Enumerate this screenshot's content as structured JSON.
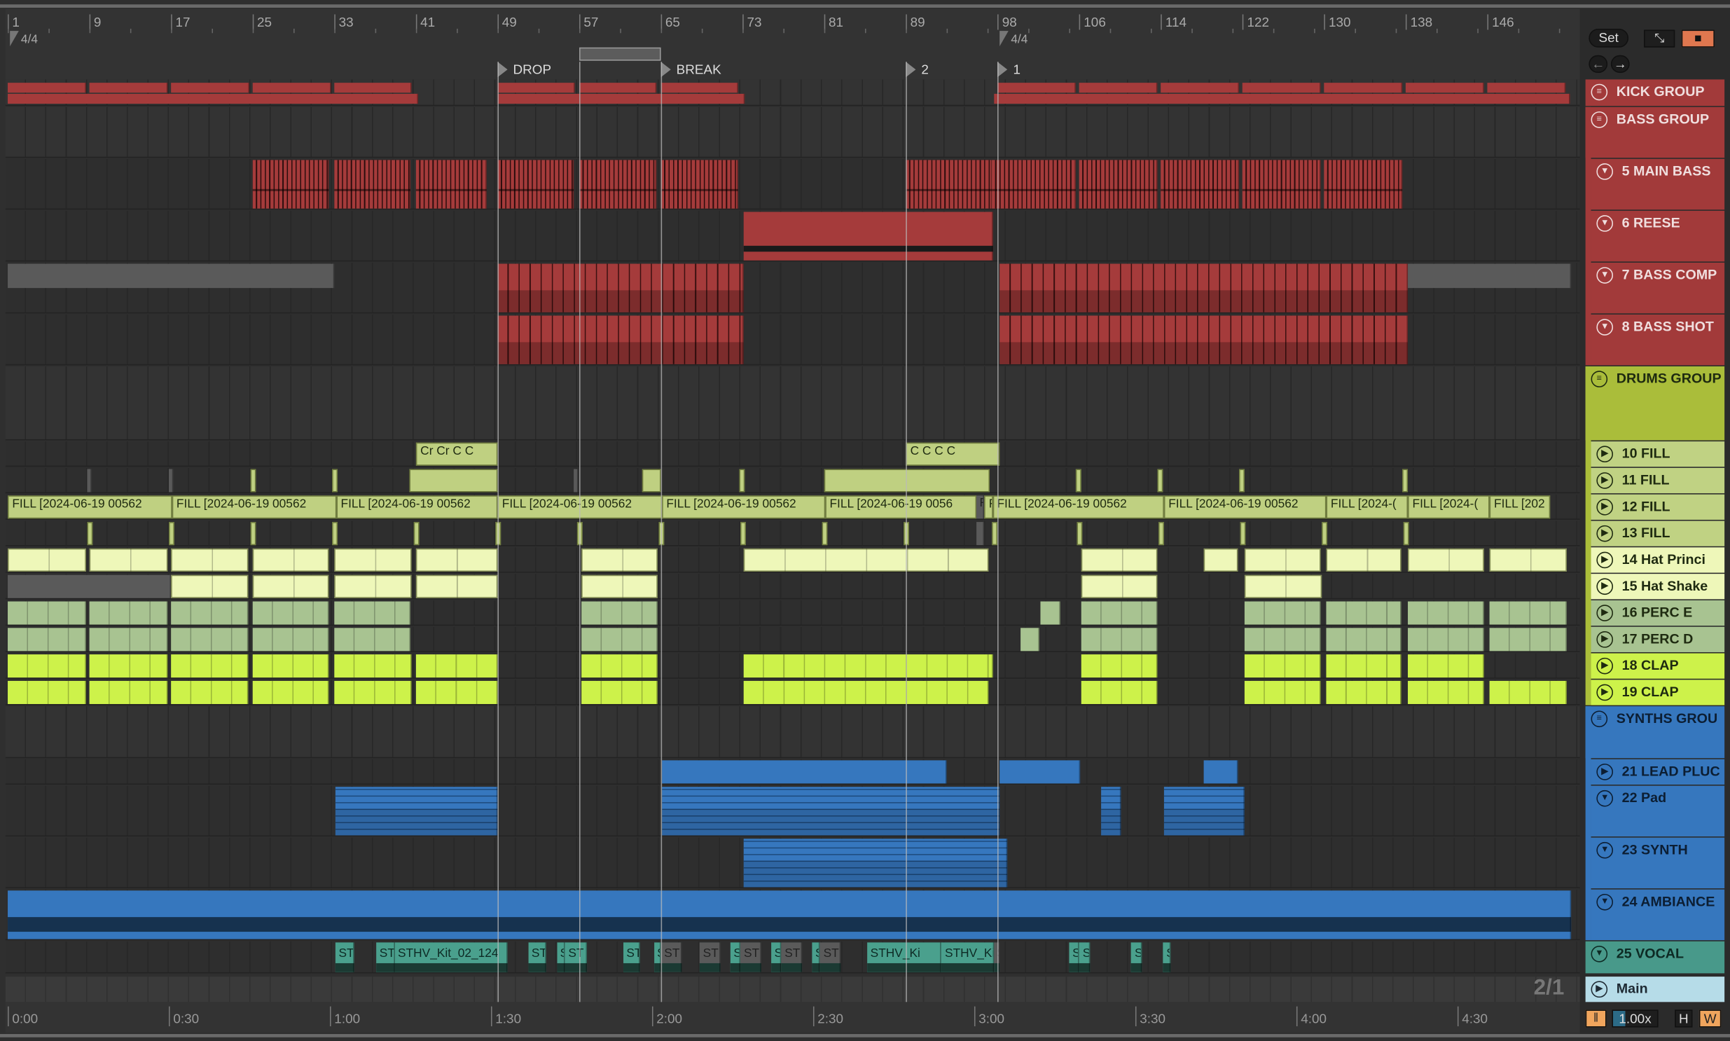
{
  "colors": {
    "red": "#a53b3b",
    "grey": "#5a5a5a",
    "fill": "#bfd081",
    "hat": "#eef7b9",
    "perc": "#a8c391",
    "clap": "#cdf24a",
    "blue": "#3677be",
    "teal": "#4aa08d",
    "drumgrp": "#aabd3a",
    "main": "#b6dce8",
    "orange": "#f0a55d"
  },
  "ruler": {
    "bars": [
      {
        "label": "1",
        "bar": 1
      },
      {
        "label": "9",
        "bar": 9
      },
      {
        "label": "17",
        "bar": 17
      },
      {
        "label": "25",
        "bar": 25
      },
      {
        "label": "33",
        "bar": 33
      },
      {
        "label": "41",
        "bar": 41
      },
      {
        "label": "49",
        "bar": 49
      },
      {
        "label": "57",
        "bar": 57
      },
      {
        "label": "65",
        "bar": 65
      },
      {
        "label": "73",
        "bar": 73
      },
      {
        "label": "81",
        "bar": 81
      },
      {
        "label": "89",
        "bar": 89
      },
      {
        "label": "98",
        "bar": 98
      },
      {
        "label": "106",
        "bar": 106
      },
      {
        "label": "114",
        "bar": 114
      },
      {
        "label": "122",
        "bar": 122
      },
      {
        "label": "130",
        "bar": 130
      },
      {
        "label": "138",
        "bar": 138
      },
      {
        "label": "146",
        "bar": 146
      }
    ],
    "time_signatures": [
      {
        "label": "4/4",
        "bar": 1
      },
      {
        "label": "4/4",
        "bar": 98
      }
    ],
    "locators": [
      {
        "label": "DROP",
        "bar": 49
      },
      {
        "label": "BREAK",
        "bar": 65
      },
      {
        "label": "2",
        "bar": 89
      },
      {
        "label": "1",
        "bar": 98
      }
    ],
    "loop": {
      "start": 57,
      "end": 65
    }
  },
  "time_ruler": [
    {
      "label": "0:00",
      "sec": 0
    },
    {
      "label": "0:30",
      "sec": 30
    },
    {
      "label": "1:00",
      "sec": 60
    },
    {
      "label": "1:30",
      "sec": 90
    },
    {
      "label": "2:00",
      "sec": 120
    },
    {
      "label": "2:30",
      "sec": 150
    },
    {
      "label": "3:00",
      "sec": 180
    },
    {
      "label": "3:30",
      "sec": 210
    },
    {
      "label": "4:00",
      "sec": 240
    },
    {
      "label": "4:30",
      "sec": 270
    }
  ],
  "controls": {
    "set": "Set",
    "zoom": "1.00x",
    "h": "H",
    "w": "W",
    "ratio": "2/1"
  },
  "tracks": [
    {
      "name": "KICK GROUP",
      "type": "group",
      "color": "red",
      "clips": [
        [
          1,
          8.7,
          "red"
        ],
        [
          9,
          16.7,
          "red"
        ],
        [
          17,
          24.7,
          "red"
        ],
        [
          25,
          32.7,
          "red"
        ],
        [
          33,
          40.6,
          "red"
        ],
        [
          49,
          56.6,
          "red"
        ],
        [
          57,
          64.6,
          "red"
        ],
        [
          65,
          72.6,
          "red"
        ],
        [
          98,
          105.7,
          "red"
        ],
        [
          106,
          113.7,
          "red"
        ],
        [
          114,
          121.6,
          "red"
        ],
        [
          122,
          129.6,
          "red"
        ],
        [
          130,
          137.6,
          "red"
        ],
        [
          138,
          145.6,
          "red"
        ],
        [
          146,
          153.6,
          "red"
        ]
      ],
      "summary": [
        [
          1,
          41.2,
          "red"
        ],
        [
          49,
          73.2,
          "red"
        ],
        [
          97.6,
          154.1,
          "red"
        ]
      ]
    },
    {
      "name": "BASS GROUP",
      "type": "group",
      "color": "red",
      "clips": []
    },
    {
      "name": "5 MAIN BASS",
      "type": "fold",
      "color": "red",
      "clips": [
        [
          25,
          32.5,
          "red"
        ],
        [
          33,
          40.5,
          "red"
        ],
        [
          41,
          47.9,
          "red"
        ],
        [
          49,
          56.5,
          "red"
        ],
        [
          57,
          64.6,
          "red"
        ],
        [
          65,
          72.6,
          "red"
        ],
        [
          89,
          97.4,
          "red"
        ],
        [
          97.4,
          105.6,
          "red"
        ],
        [
          106,
          113.6,
          "red"
        ],
        [
          114,
          121.6,
          "red"
        ],
        [
          122,
          129.6,
          "red"
        ],
        [
          130,
          137.6,
          "red"
        ]
      ]
    },
    {
      "name": "6 REESE",
      "type": "fold",
      "color": "red",
      "clips": [
        [
          73.1,
          97.5,
          "red"
        ]
      ]
    },
    {
      "name": "7 BASS COMP",
      "type": "fold",
      "color": "red",
      "clips": [
        [
          1,
          33,
          "grey"
        ],
        [
          49,
          73.1,
          "red"
        ],
        [
          98.2,
          138.2,
          "red"
        ],
        [
          138.2,
          154.2,
          "grey"
        ]
      ]
    },
    {
      "name": "8 BASS SHOT",
      "type": "fold",
      "color": "red",
      "clips": [
        [
          49,
          73.1,
          "red"
        ],
        [
          98.2,
          138.2,
          "red"
        ]
      ]
    },
    {
      "name": "DRUMS GROUP",
      "type": "group",
      "color": "drumgrp",
      "clips": []
    },
    {
      "name": "10 FILL",
      "type": "play",
      "color": "fill",
      "clips": [
        [
          41,
          49,
          "fill",
          "Cr Cr C C"
        ],
        [
          89,
          98.2,
          "fill",
          "C C C C"
        ]
      ]
    },
    {
      "name": "11 FILL",
      "type": "play",
      "color": "fill",
      "clips": [
        [
          8.8,
          9.1,
          "grey"
        ],
        [
          16.8,
          17.1,
          "grey"
        ],
        [
          24.8,
          25.1,
          "fill"
        ],
        [
          32.8,
          33.1,
          "fill"
        ],
        [
          40.4,
          49,
          "fill"
        ],
        [
          56.5,
          56.9,
          "grey"
        ],
        [
          63.2,
          65,
          "fill"
        ],
        [
          72.7,
          73,
          "fill"
        ],
        [
          81,
          97.2,
          "fill"
        ],
        [
          105.6,
          105.9,
          "fill"
        ],
        [
          113.6,
          113.9,
          "fill"
        ],
        [
          121.6,
          121.9,
          "fill"
        ],
        [
          137.7,
          138,
          "fill"
        ]
      ]
    },
    {
      "name": "12 FILL",
      "type": "play",
      "color": "fill",
      "clips": [
        [
          1,
          17.1,
          "fill",
          "FILL [2024-06-19 00562"
        ],
        [
          17.1,
          33.2,
          "fill",
          "FILL [2024-06-19 00562"
        ],
        [
          33.2,
          49,
          "fill",
          "FILL [2024-06-19 00562"
        ],
        [
          49,
          65.1,
          "fill",
          "FILL [2024-06-19 00562"
        ],
        [
          65.1,
          81.1,
          "fill",
          "FILL [2024-06-19 00562"
        ],
        [
          81.1,
          95.9,
          "fill",
          "FILL [2024-06-19 0056"
        ],
        [
          95.9,
          96.7,
          "grey",
          "F"
        ],
        [
          96.7,
          97.5,
          "fill",
          "F"
        ],
        [
          97.5,
          114.3,
          "fill",
          "FILL [2024-06-19 00562"
        ],
        [
          114.3,
          130.2,
          "fill",
          "FILL [2024-06-19 00562"
        ],
        [
          130.2,
          138.2,
          "fill",
          "FILL [2024-("
        ],
        [
          138.2,
          146.2,
          "fill",
          "FILL [2024-("
        ],
        [
          146.2,
          152.1,
          "fill",
          "FILL [202"
        ]
      ]
    },
    {
      "name": "13 FILL",
      "type": "play",
      "color": "fill",
      "clips": [
        [
          8.8,
          9.1,
          "fill"
        ],
        [
          16.8,
          17.1,
          "fill"
        ],
        [
          24.8,
          25.1,
          "fill"
        ],
        [
          32.8,
          33.1,
          "fill"
        ],
        [
          40.8,
          41.1,
          "fill"
        ],
        [
          48.8,
          49.1,
          "fill"
        ],
        [
          56.8,
          57.1,
          "fill"
        ],
        [
          64.8,
          65.1,
          "fill"
        ],
        [
          72.8,
          73.1,
          "fill"
        ],
        [
          80.8,
          81.1,
          "fill"
        ],
        [
          88.8,
          89.1,
          "fill"
        ],
        [
          95.9,
          96.7,
          "grey"
        ],
        [
          97.4,
          97.7,
          "fill"
        ],
        [
          105.8,
          106.1,
          "fill"
        ],
        [
          113.8,
          114.1,
          "fill"
        ],
        [
          121.8,
          122.1,
          "fill"
        ],
        [
          129.8,
          130.1,
          "fill"
        ],
        [
          137.8,
          138.1,
          "fill"
        ]
      ]
    },
    {
      "name": "14 Hat Princi",
      "type": "play",
      "color": "hat",
      "clips": [
        [
          1,
          8.7,
          "hat"
        ],
        [
          9,
          16.7,
          "hat"
        ],
        [
          17,
          24.6,
          "hat"
        ],
        [
          25,
          32.5,
          "hat"
        ],
        [
          33,
          40.6,
          "hat"
        ],
        [
          41,
          49,
          "hat"
        ],
        [
          57.2,
          64.7,
          "hat"
        ],
        [
          73.1,
          97.1,
          "hat"
        ],
        [
          106.2,
          113.6,
          "hat"
        ],
        [
          118.2,
          121.5,
          "hat"
        ],
        [
          122.2,
          129.6,
          "hat"
        ],
        [
          130.2,
          137.5,
          "hat"
        ],
        [
          138.2,
          145.6,
          "hat"
        ],
        [
          146.2,
          153.8,
          "hat"
        ]
      ]
    },
    {
      "name": "15 Hat Shake",
      "type": "play",
      "color": "hat",
      "clips": [
        [
          1,
          17,
          "grey"
        ],
        [
          17,
          24.6,
          "hat"
        ],
        [
          25,
          32.5,
          "hat"
        ],
        [
          33,
          40.6,
          "hat"
        ],
        [
          41,
          49,
          "hat"
        ],
        [
          57.2,
          64.7,
          "hat"
        ],
        [
          106.2,
          113.7,
          "hat"
        ],
        [
          122.2,
          129.8,
          "hat"
        ]
      ]
    },
    {
      "name": "16 PERC E",
      "type": "play",
      "color": "perc",
      "clips": [
        [
          1,
          8.7,
          "perc"
        ],
        [
          9,
          16.7,
          "perc"
        ],
        [
          17,
          24.6,
          "perc"
        ],
        [
          25,
          32.5,
          "perc"
        ],
        [
          33,
          40.5,
          "perc"
        ],
        [
          57.2,
          64.7,
          "perc"
        ],
        [
          102.2,
          104.1,
          "perc"
        ],
        [
          106.2,
          113.6,
          "perc"
        ],
        [
          122.2,
          129.6,
          "perc"
        ],
        [
          130.2,
          137.5,
          "perc"
        ],
        [
          138.2,
          145.6,
          "perc"
        ],
        [
          146.2,
          153.8,
          "perc"
        ]
      ]
    },
    {
      "name": "17 PERC D",
      "type": "play",
      "color": "perc",
      "clips": [
        [
          1,
          8.7,
          "perc"
        ],
        [
          9,
          16.7,
          "perc"
        ],
        [
          17,
          24.6,
          "perc"
        ],
        [
          25,
          32.5,
          "perc"
        ],
        [
          33,
          40.5,
          "perc"
        ],
        [
          57.2,
          64.7,
          "perc"
        ],
        [
          100.2,
          102.1,
          "perc"
        ],
        [
          106.2,
          113.6,
          "perc"
        ],
        [
          122.2,
          129.6,
          "perc"
        ],
        [
          130.2,
          137.5,
          "perc"
        ],
        [
          138.2,
          145.6,
          "perc"
        ],
        [
          146.2,
          153.8,
          "perc"
        ]
      ]
    },
    {
      "name": "18 CLAP",
      "type": "play",
      "color": "clap",
      "clips": [
        [
          1,
          8.7,
          "clap"
        ],
        [
          9,
          16.7,
          "clap"
        ],
        [
          17,
          24.6,
          "clap"
        ],
        [
          25,
          32.5,
          "clap"
        ],
        [
          33,
          40.6,
          "clap"
        ],
        [
          41,
          49,
          "clap"
        ],
        [
          57.2,
          64.7,
          "clap"
        ],
        [
          73.1,
          97.5,
          "clap"
        ],
        [
          106.2,
          113.6,
          "clap"
        ],
        [
          122.2,
          129.6,
          "clap"
        ],
        [
          130.2,
          137.5,
          "clap"
        ],
        [
          138.2,
          145.6,
          "clap"
        ]
      ]
    },
    {
      "name": "19 CLAP",
      "type": "play",
      "color": "clap",
      "clips": [
        [
          1,
          8.7,
          "clap"
        ],
        [
          9,
          16.7,
          "clap"
        ],
        [
          17,
          24.6,
          "clap"
        ],
        [
          25,
          32.5,
          "clap"
        ],
        [
          33,
          40.6,
          "clap"
        ],
        [
          41,
          49,
          "clap"
        ],
        [
          57.2,
          64.7,
          "clap"
        ],
        [
          73.1,
          97.1,
          "clap"
        ],
        [
          106.2,
          113.6,
          "clap"
        ],
        [
          122.2,
          129.6,
          "clap"
        ],
        [
          130.2,
          137.5,
          "clap"
        ],
        [
          138.2,
          145.6,
          "clap"
        ],
        [
          146.2,
          153.8,
          "clap"
        ]
      ]
    },
    {
      "name": "SYNTHS GROU",
      "type": "group",
      "color": "blue",
      "clips": []
    },
    {
      "name": "21 LEAD PLUC",
      "type": "play",
      "color": "blue",
      "clips": [
        [
          65.1,
          93,
          "blue"
        ],
        [
          98.2,
          106.1,
          "blue"
        ],
        [
          118.2,
          121.5,
          "blue"
        ]
      ]
    },
    {
      "name": "22 Pad",
      "type": "fold",
      "color": "blue",
      "clips": [
        [
          33.1,
          49,
          "blue"
        ],
        [
          65.1,
          98.2,
          "blue"
        ],
        [
          108.1,
          110.1,
          "blue"
        ],
        [
          114.3,
          122.2,
          "blue"
        ]
      ]
    },
    {
      "name": "23 SYNTH",
      "type": "fold",
      "color": "blue",
      "clips": [
        [
          73.1,
          99,
          "blue"
        ]
      ]
    },
    {
      "name": "24 AMBIANCE",
      "type": "fold",
      "color": "blue",
      "clips": [
        [
          1,
          154.2,
          "blue"
        ]
      ]
    },
    {
      "name": "25 VOCAL",
      "type": "fold",
      "color": "teal",
      "clips": [
        [
          33.1,
          34.9,
          "teal",
          "ST"
        ],
        [
          37.1,
          38.9,
          "teal",
          "ST"
        ],
        [
          38.9,
          50,
          "teal",
          "STHV_Kit_02_124"
        ],
        [
          52,
          53.8,
          "teal",
          "ST"
        ],
        [
          54.8,
          55.6,
          "teal",
          "S"
        ],
        [
          55.6,
          57.8,
          "teal",
          "ST"
        ],
        [
          61.3,
          63,
          "teal",
          "ST"
        ],
        [
          64.3,
          65,
          "teal",
          "S"
        ],
        [
          65,
          67,
          "grey",
          "ST"
        ],
        [
          68.8,
          70.8,
          "grey",
          "ST"
        ],
        [
          71.8,
          72.8,
          "teal",
          "S"
        ],
        [
          72.8,
          74.8,
          "grey",
          "ST"
        ],
        [
          75.8,
          76.8,
          "teal",
          "S"
        ],
        [
          76.8,
          78.8,
          "grey",
          "ST"
        ],
        [
          79.8,
          80.6,
          "teal",
          "S"
        ],
        [
          80.6,
          82.6,
          "grey",
          "ST"
        ],
        [
          85.2,
          92.5,
          "teal",
          "STHV_Ki"
        ],
        [
          92.5,
          97.6,
          "teal",
          "STHV_Ki"
        ],
        [
          97.6,
          98.2,
          "grey",
          "S"
        ],
        [
          105,
          106,
          "teal",
          "S"
        ],
        [
          106,
          107,
          "teal",
          "S"
        ],
        [
          111.1,
          112.1,
          "teal",
          "S"
        ],
        [
          114.2,
          115,
          "teal",
          "S"
        ]
      ]
    },
    {
      "name": "Main",
      "type": "main",
      "color": "main",
      "clips": []
    }
  ]
}
